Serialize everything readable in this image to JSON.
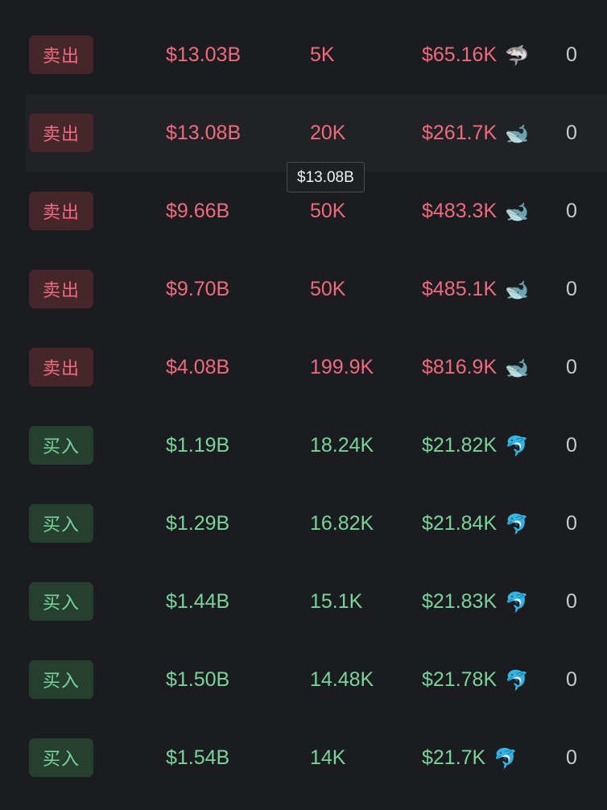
{
  "rows": [
    {
      "side": "sell",
      "badge": "卖出",
      "market_cap": "$13.03B",
      "amount": "5K",
      "value": "$65.16K",
      "icon": "shark-icon",
      "count": "0",
      "hovered": false
    },
    {
      "side": "sell",
      "badge": "卖出",
      "market_cap": "$13.08B",
      "amount": "20K",
      "value": "$261.7K",
      "icon": "whale-icon",
      "count": "0",
      "hovered": true
    },
    {
      "side": "sell",
      "badge": "卖出",
      "market_cap": "$9.66B",
      "amount": "50K",
      "value": "$483.3K",
      "icon": "whale-icon",
      "count": "0",
      "hovered": false
    },
    {
      "side": "sell",
      "badge": "卖出",
      "market_cap": "$9.70B",
      "amount": "50K",
      "value": "$485.1K",
      "icon": "whale-icon",
      "count": "0",
      "hovered": false
    },
    {
      "side": "sell",
      "badge": "卖出",
      "market_cap": "$4.08B",
      "amount": "199.9K",
      "value": "$816.9K",
      "icon": "whale-icon",
      "count": "0",
      "hovered": false
    },
    {
      "side": "buy",
      "badge": "买入",
      "market_cap": "$1.19B",
      "amount": "18.24K",
      "value": "$21.82K",
      "icon": "dolphin-icon",
      "count": "0",
      "hovered": false
    },
    {
      "side": "buy",
      "badge": "买入",
      "market_cap": "$1.29B",
      "amount": "16.82K",
      "value": "$21.84K",
      "icon": "dolphin-icon",
      "count": "0",
      "hovered": false
    },
    {
      "side": "buy",
      "badge": "买入",
      "market_cap": "$1.44B",
      "amount": "15.1K",
      "value": "$21.83K",
      "icon": "dolphin-icon",
      "count": "0",
      "hovered": false
    },
    {
      "side": "buy",
      "badge": "买入",
      "market_cap": "$1.50B",
      "amount": "14.48K",
      "value": "$21.78K",
      "icon": "dolphin-icon",
      "count": "0",
      "hovered": false
    },
    {
      "side": "buy",
      "badge": "买入",
      "market_cap": "$1.54B",
      "amount": "14K",
      "value": "$21.7K",
      "icon": "dolphin-icon",
      "count": "0",
      "hovered": false
    }
  ],
  "tooltip": {
    "text": "$13.08B"
  },
  "colors": {
    "sell": "#ef6a7e",
    "buy": "#7ad39a",
    "sell_badge_bg": "#45262b",
    "buy_badge_bg": "#26402f",
    "background": "#1b1c1f"
  },
  "icons": {
    "shark-icon": "🦈",
    "whale-icon": "🐋",
    "dolphin-icon": "🐬"
  }
}
